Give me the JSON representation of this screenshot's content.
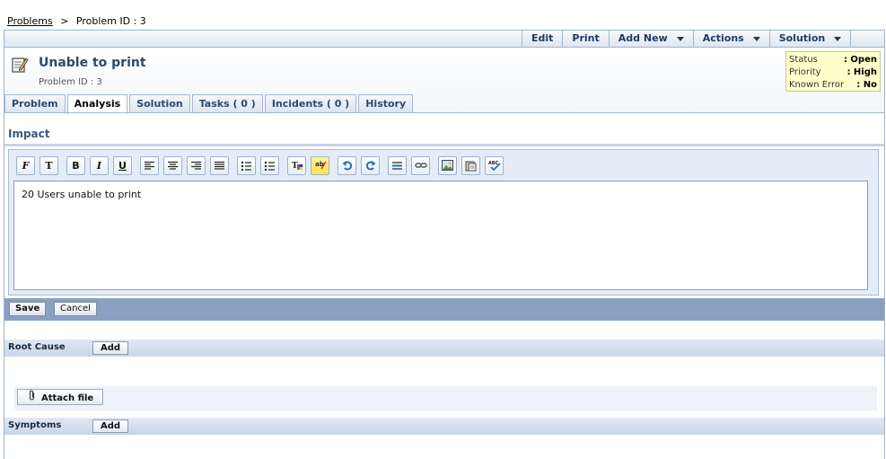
{
  "breadcrumb": {
    "root": "Problems",
    "separator": ">",
    "current": "Problem ID : 3"
  },
  "topbar": {
    "items": [
      {
        "label": "Edit",
        "dropdown": false
      },
      {
        "label": "Print",
        "dropdown": false
      },
      {
        "label": "Add New",
        "dropdown": true
      },
      {
        "label": "Actions",
        "dropdown": true
      },
      {
        "label": "Solution",
        "dropdown": true
      }
    ]
  },
  "header": {
    "title": "Unable to print",
    "subtitle": "Problem ID : 3",
    "icon": "edit-note-icon"
  },
  "status": {
    "rows": [
      {
        "key": "Status",
        "value": ": Open"
      },
      {
        "key": "Priority",
        "value": ": High"
      },
      {
        "key": "Known Error",
        "value": ": No"
      }
    ]
  },
  "tabs": [
    {
      "label": "Problem",
      "active": false
    },
    {
      "label": "Analysis",
      "active": true
    },
    {
      "label": "Solution",
      "active": false
    },
    {
      "label": "Tasks ( 0 )",
      "active": false
    },
    {
      "label": "Incidents ( 0 )",
      "active": false
    },
    {
      "label": "History",
      "active": false
    }
  ],
  "impact": {
    "title": "Impact",
    "content": "20 Users unable to print",
    "toolbar_icons": [
      "font-family-icon",
      "font-size-icon",
      "bold-icon",
      "italic-icon",
      "underline-icon",
      "align-left-icon",
      "align-center-icon",
      "align-right-icon",
      "justify-icon",
      "numbered-list-icon",
      "bullet-list-icon",
      "text-color-icon",
      "highlight-icon",
      "undo-icon",
      "redo-icon",
      "horizontal-rule-icon",
      "link-icon",
      "insert-image-icon",
      "paste-icon",
      "spellcheck-icon"
    ]
  },
  "actions": {
    "save": "Save",
    "cancel": "Cancel"
  },
  "root_cause": {
    "label": "Root Cause",
    "add": "Add"
  },
  "attach": {
    "label": "Attach file"
  },
  "symptoms": {
    "label": "Symptoms",
    "add": "Add"
  },
  "colors": {
    "accent": "#2c4a6b",
    "savebar": "#8aa0c2",
    "status_bg": "#ffffcc"
  }
}
